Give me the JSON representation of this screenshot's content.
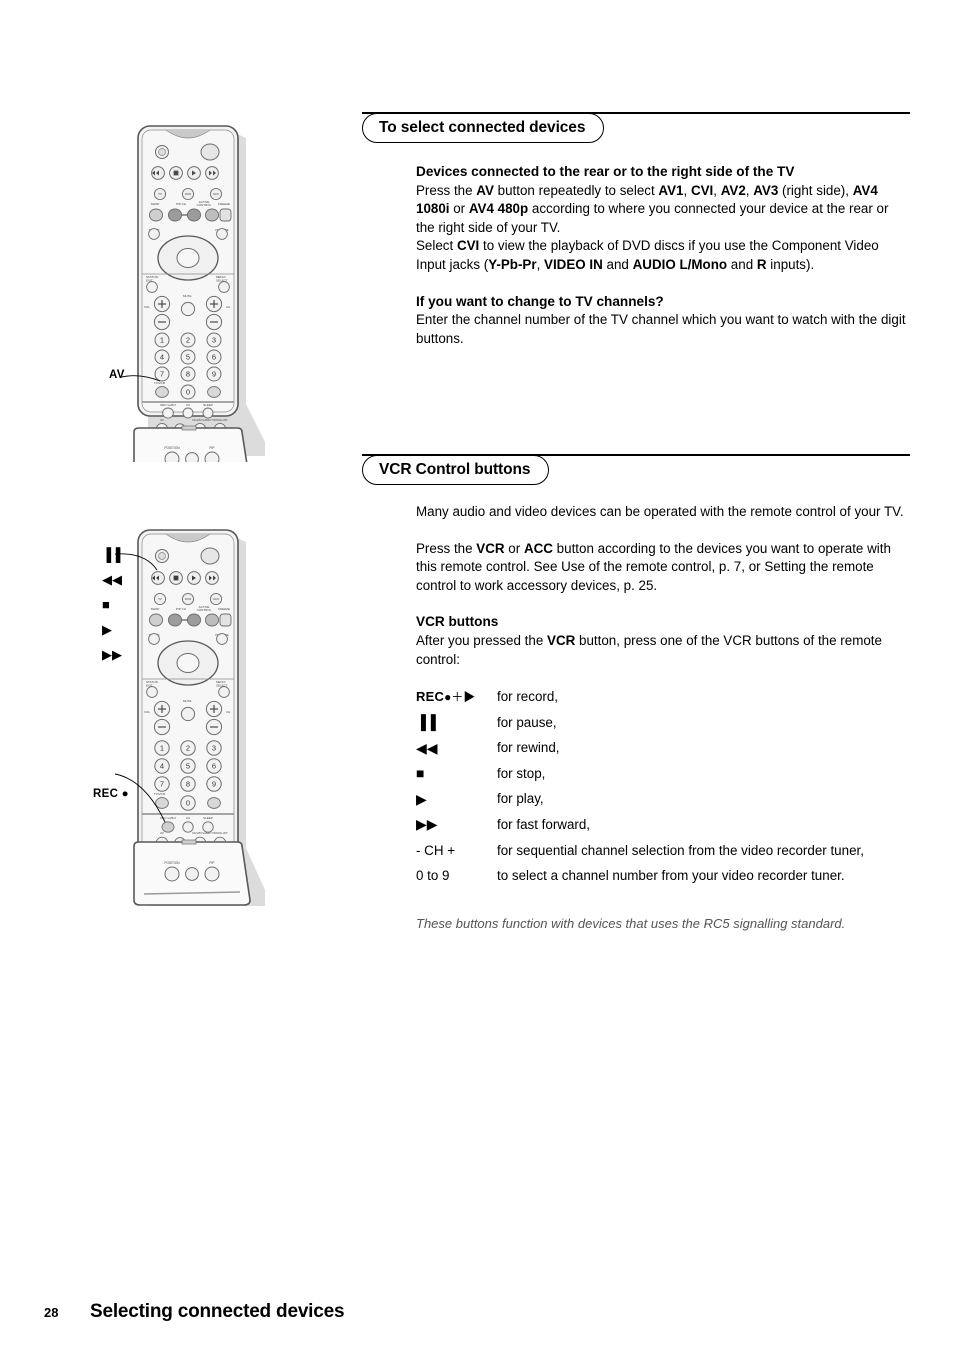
{
  "page": {
    "number": "28",
    "footer_title": "Selecting connected devices"
  },
  "sections": [
    {
      "id": "select-connected-devices",
      "heading": "To select connected devices",
      "sub1": "Devices connected to the rear or to the right side of the TV",
      "para1_runs": [
        {
          "t": "Press the ",
          "b": false
        },
        {
          "t": "AV",
          "b": true
        },
        {
          "t": " button repeatedly to select ",
          "b": false
        },
        {
          "t": "AV1",
          "b": true
        },
        {
          "t": ", ",
          "b": false
        },
        {
          "t": "CVI",
          "b": true
        },
        {
          "t": ", ",
          "b": false
        },
        {
          "t": "AV2",
          "b": true
        },
        {
          "t": ", ",
          "b": false
        },
        {
          "t": "AV3",
          "b": true
        },
        {
          "t": " (right side), ",
          "b": false
        },
        {
          "t": "AV4 1080i",
          "b": true
        },
        {
          "t": " or ",
          "b": false
        },
        {
          "t": "AV4 480p",
          "b": true
        },
        {
          "t": " according to where you connected your device at the rear or the right side of your TV.",
          "b": false
        }
      ],
      "para2_runs": [
        {
          "t": "Select ",
          "b": false
        },
        {
          "t": "CVI",
          "b": true
        },
        {
          "t": " to view the playback of DVD discs if you use the Component Video Input jacks (",
          "b": false
        },
        {
          "t": "Y-Pb-Pr",
          "b": true
        },
        {
          "t": ", ",
          "b": false
        },
        {
          "t": "VIDEO IN",
          "b": true
        },
        {
          "t": " and ",
          "b": false
        },
        {
          "t": "AUDIO L/Mono",
          "b": true
        },
        {
          "t": " and ",
          "b": false
        },
        {
          "t": "R",
          "b": true
        },
        {
          "t": " inputs).",
          "b": false
        }
      ],
      "sub2": "If you want to change to TV channels?",
      "para3": "Enter the channel number of the TV channel which you want to watch with the digit buttons."
    },
    {
      "id": "vcr-control-buttons",
      "heading": "VCR Control buttons",
      "para1": "Many audio and video devices can be operated with the remote control of your TV.",
      "para2_runs": [
        {
          "t": "Press the ",
          "b": false
        },
        {
          "t": "VCR",
          "b": true
        },
        {
          "t": " or ",
          "b": false
        },
        {
          "t": "ACC",
          "b": true
        },
        {
          "t": " button according to the devices you want to operate with this remote control. See Use of the remote control, p. 7, or Setting the remote control to work accessory devices, p. 25.",
          "b": false
        }
      ],
      "sub1_runs": [
        {
          "t": "VCR",
          "b": true
        },
        {
          "t": " buttons",
          "b": false
        }
      ],
      "para3_runs": [
        {
          "t": "After you pressed the ",
          "b": false
        },
        {
          "t": "VCR",
          "b": true
        },
        {
          "t": " button, press one of the VCR buttons of the remote control:",
          "b": false
        }
      ],
      "note": "These buttons function with devices that uses the RC5 signalling standard."
    }
  ],
  "vcr_keys": [
    {
      "key_text": "REC",
      "key_glyph": "●＋▶",
      "key_style": "rec",
      "desc": "for record,"
    },
    {
      "key_text": "",
      "key_glyph": "▐▐",
      "key_style": "pause",
      "desc": "for pause,"
    },
    {
      "key_text": "",
      "key_glyph": "◀◀",
      "key_style": "rew",
      "desc": "for rewind,"
    },
    {
      "key_text": "",
      "key_glyph": "■",
      "key_style": "stop",
      "desc": "for stop,"
    },
    {
      "key_text": "",
      "key_glyph": "▶",
      "key_style": "play",
      "desc": "for play,"
    },
    {
      "key_text": "",
      "key_glyph": "▶▶",
      "key_style": "ff",
      "desc": "for fast forward,"
    },
    {
      "key_text": "- CH +",
      "key_glyph": "",
      "key_style": "ch",
      "desc": "for sequential channel selection from the video recorder tuner,"
    },
    {
      "key_text": "0 to 9",
      "key_glyph": "",
      "key_style": "digits",
      "desc": "to select a channel number from your video recorder tuner."
    }
  ],
  "figures": {
    "remote_top": {
      "callout_label": "AV",
      "keypad_digits": [
        "1",
        "2",
        "3",
        "4",
        "5",
        "6",
        "7",
        "8",
        "9",
        "0"
      ],
      "micro_labels": {
        "swap": "SWAP",
        "pip_ch": "PIP CH",
        "active_control": "ACTIVE CONTROL",
        "freeze": "FREEZE",
        "sound": "SOUND",
        "picture": "PICTURE",
        "status_exit": "STATUS/ EXIT",
        "menu_select": "MENU/ SELECT",
        "vol": "VOL",
        "ch": "CH",
        "mute": "MUTE",
        "ok": "OK",
        "tv_vcr": "TV/VCR",
        "rec": "REC",
        "cc": "CC",
        "sleep": "SLEEP",
        "av": "AV",
        "dolby_proglist": "DOLBY· PROGLIST",
        "position": "POSITION",
        "pip": "PIP"
      }
    },
    "remote_bottom": {
      "callout_label": "REC ●",
      "side_glyphs": [
        "▐▐",
        "◀◀",
        "■",
        "▶",
        "▶▶"
      ]
    }
  },
  "colors": {
    "ink": "#000000",
    "paper": "#ffffff",
    "remote_body": "#f2f2f2",
    "remote_outline": "#58585a",
    "remote_shadow": "#d9d9d9",
    "button_grey": "#b3b3b3",
    "note_grey": "#555555"
  }
}
